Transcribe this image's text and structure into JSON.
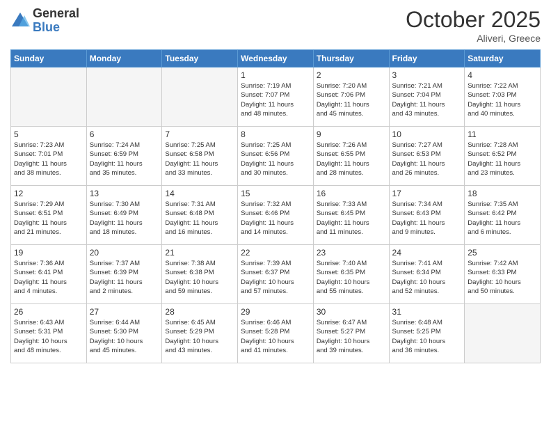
{
  "logo": {
    "general": "General",
    "blue": "Blue"
  },
  "title": "October 2025",
  "location": "Aliveri, Greece",
  "days_of_week": [
    "Sunday",
    "Monday",
    "Tuesday",
    "Wednesday",
    "Thursday",
    "Friday",
    "Saturday"
  ],
  "rows": [
    [
      {
        "day": "",
        "info": ""
      },
      {
        "day": "",
        "info": ""
      },
      {
        "day": "",
        "info": ""
      },
      {
        "day": "1",
        "info": "Sunrise: 7:19 AM\nSunset: 7:07 PM\nDaylight: 11 hours\nand 48 minutes."
      },
      {
        "day": "2",
        "info": "Sunrise: 7:20 AM\nSunset: 7:06 PM\nDaylight: 11 hours\nand 45 minutes."
      },
      {
        "day": "3",
        "info": "Sunrise: 7:21 AM\nSunset: 7:04 PM\nDaylight: 11 hours\nand 43 minutes."
      },
      {
        "day": "4",
        "info": "Sunrise: 7:22 AM\nSunset: 7:03 PM\nDaylight: 11 hours\nand 40 minutes."
      }
    ],
    [
      {
        "day": "5",
        "info": "Sunrise: 7:23 AM\nSunset: 7:01 PM\nDaylight: 11 hours\nand 38 minutes."
      },
      {
        "day": "6",
        "info": "Sunrise: 7:24 AM\nSunset: 6:59 PM\nDaylight: 11 hours\nand 35 minutes."
      },
      {
        "day": "7",
        "info": "Sunrise: 7:25 AM\nSunset: 6:58 PM\nDaylight: 11 hours\nand 33 minutes."
      },
      {
        "day": "8",
        "info": "Sunrise: 7:25 AM\nSunset: 6:56 PM\nDaylight: 11 hours\nand 30 minutes."
      },
      {
        "day": "9",
        "info": "Sunrise: 7:26 AM\nSunset: 6:55 PM\nDaylight: 11 hours\nand 28 minutes."
      },
      {
        "day": "10",
        "info": "Sunrise: 7:27 AM\nSunset: 6:53 PM\nDaylight: 11 hours\nand 26 minutes."
      },
      {
        "day": "11",
        "info": "Sunrise: 7:28 AM\nSunset: 6:52 PM\nDaylight: 11 hours\nand 23 minutes."
      }
    ],
    [
      {
        "day": "12",
        "info": "Sunrise: 7:29 AM\nSunset: 6:51 PM\nDaylight: 11 hours\nand 21 minutes."
      },
      {
        "day": "13",
        "info": "Sunrise: 7:30 AM\nSunset: 6:49 PM\nDaylight: 11 hours\nand 18 minutes."
      },
      {
        "day": "14",
        "info": "Sunrise: 7:31 AM\nSunset: 6:48 PM\nDaylight: 11 hours\nand 16 minutes."
      },
      {
        "day": "15",
        "info": "Sunrise: 7:32 AM\nSunset: 6:46 PM\nDaylight: 11 hours\nand 14 minutes."
      },
      {
        "day": "16",
        "info": "Sunrise: 7:33 AM\nSunset: 6:45 PM\nDaylight: 11 hours\nand 11 minutes."
      },
      {
        "day": "17",
        "info": "Sunrise: 7:34 AM\nSunset: 6:43 PM\nDaylight: 11 hours\nand 9 minutes."
      },
      {
        "day": "18",
        "info": "Sunrise: 7:35 AM\nSunset: 6:42 PM\nDaylight: 11 hours\nand 6 minutes."
      }
    ],
    [
      {
        "day": "19",
        "info": "Sunrise: 7:36 AM\nSunset: 6:41 PM\nDaylight: 11 hours\nand 4 minutes."
      },
      {
        "day": "20",
        "info": "Sunrise: 7:37 AM\nSunset: 6:39 PM\nDaylight: 11 hours\nand 2 minutes."
      },
      {
        "day": "21",
        "info": "Sunrise: 7:38 AM\nSunset: 6:38 PM\nDaylight: 10 hours\nand 59 minutes."
      },
      {
        "day": "22",
        "info": "Sunrise: 7:39 AM\nSunset: 6:37 PM\nDaylight: 10 hours\nand 57 minutes."
      },
      {
        "day": "23",
        "info": "Sunrise: 7:40 AM\nSunset: 6:35 PM\nDaylight: 10 hours\nand 55 minutes."
      },
      {
        "day": "24",
        "info": "Sunrise: 7:41 AM\nSunset: 6:34 PM\nDaylight: 10 hours\nand 52 minutes."
      },
      {
        "day": "25",
        "info": "Sunrise: 7:42 AM\nSunset: 6:33 PM\nDaylight: 10 hours\nand 50 minutes."
      }
    ],
    [
      {
        "day": "26",
        "info": "Sunrise: 6:43 AM\nSunset: 5:31 PM\nDaylight: 10 hours\nand 48 minutes."
      },
      {
        "day": "27",
        "info": "Sunrise: 6:44 AM\nSunset: 5:30 PM\nDaylight: 10 hours\nand 45 minutes."
      },
      {
        "day": "28",
        "info": "Sunrise: 6:45 AM\nSunset: 5:29 PM\nDaylight: 10 hours\nand 43 minutes."
      },
      {
        "day": "29",
        "info": "Sunrise: 6:46 AM\nSunset: 5:28 PM\nDaylight: 10 hours\nand 41 minutes."
      },
      {
        "day": "30",
        "info": "Sunrise: 6:47 AM\nSunset: 5:27 PM\nDaylight: 10 hours\nand 39 minutes."
      },
      {
        "day": "31",
        "info": "Sunrise: 6:48 AM\nSunset: 5:25 PM\nDaylight: 10 hours\nand 36 minutes."
      },
      {
        "day": "",
        "info": ""
      }
    ]
  ]
}
